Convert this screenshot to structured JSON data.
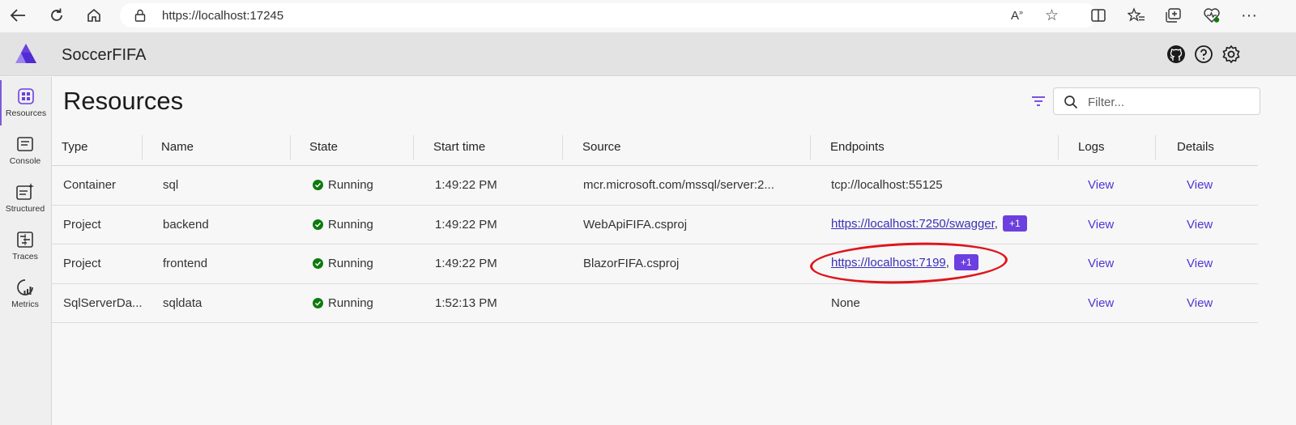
{
  "browser": {
    "url": "https://localhost:17245"
  },
  "app": {
    "title": "SoccerFIFA",
    "accent": "#7a5cdb"
  },
  "sidebar": {
    "items": [
      {
        "label": "Resources",
        "icon": "grid-icon"
      },
      {
        "label": "Console",
        "icon": "console-icon"
      },
      {
        "label": "Structured",
        "icon": "structured-logs-icon"
      },
      {
        "label": "Traces",
        "icon": "traces-icon"
      },
      {
        "label": "Metrics",
        "icon": "metrics-icon"
      }
    ]
  },
  "main": {
    "title": "Resources",
    "filter_placeholder": "Filter..."
  },
  "table": {
    "columns": [
      "Type",
      "Name",
      "State",
      "Start time",
      "Source",
      "Endpoints",
      "Logs",
      "Details"
    ],
    "rows": [
      {
        "type": "Container",
        "name": "sql",
        "state": "Running",
        "start": "1:49:22 PM",
        "source": "mcr.microsoft.com/mssql/server:2...",
        "endpoint": "tcp://localhost:55125",
        "endpoint_is_link": false,
        "extra": "",
        "logs": "View",
        "details": "View"
      },
      {
        "type": "Project",
        "name": "backend",
        "state": "Running",
        "start": "1:49:22 PM",
        "source": "WebApiFIFA.csproj",
        "endpoint": "https://localhost:7250/swagger",
        "endpoint_is_link": true,
        "extra": "+1",
        "logs": "View",
        "details": "View"
      },
      {
        "type": "Project",
        "name": "frontend",
        "state": "Running",
        "start": "1:49:22 PM",
        "source": "BlazorFIFA.csproj",
        "endpoint": "https://localhost:7199",
        "endpoint_is_link": true,
        "extra": "+1",
        "logs": "View",
        "details": "View"
      },
      {
        "type": "SqlServerDa...",
        "name": "sqldata",
        "state": "Running",
        "start": "1:52:13 PM",
        "source": "",
        "endpoint": "None",
        "endpoint_is_link": false,
        "extra": "",
        "logs": "View",
        "details": "View"
      }
    ]
  },
  "colors": {
    "running": "#0e7a0d",
    "badge": "#6b3fe0",
    "annotation": "#e0141c"
  }
}
